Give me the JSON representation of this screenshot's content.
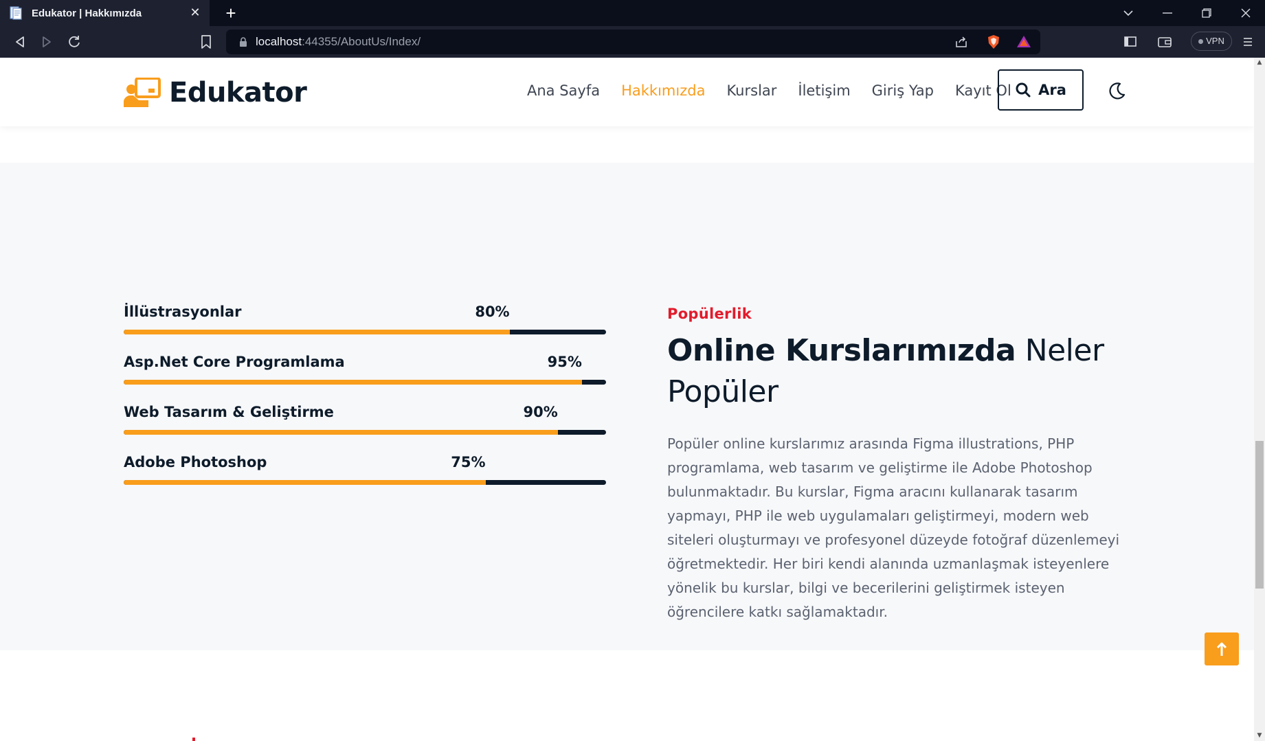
{
  "browser": {
    "tab_title": "Edukator | Hakkımızda",
    "url_host": "localhost",
    "url_rest": ":44355/AboutUs/Index/",
    "vpn_label": "VPN"
  },
  "header": {
    "logo_text": "Edukator",
    "menu": [
      {
        "label": "Ana Sayfa",
        "active": false
      },
      {
        "label": "Hakkımızda",
        "active": true
      },
      {
        "label": "Kurslar",
        "active": false
      },
      {
        "label": "İletişim",
        "active": false
      },
      {
        "label": "Giriş Yap",
        "active": false
      },
      {
        "label": "Kayıt Ol",
        "active": false
      }
    ],
    "search_label": "Ara"
  },
  "skills": [
    {
      "name": "İllüstrasyonlar",
      "percent_label": "80%",
      "percent": 80
    },
    {
      "name": "Asp.Net Core Programlama",
      "percent_label": "95%",
      "percent": 95
    },
    {
      "name": "Web Tasarım & Geliştirme",
      "percent_label": "90%",
      "percent": 90
    },
    {
      "name": "Adobe Photoshop",
      "percent_label": "75%",
      "percent": 75
    }
  ],
  "content": {
    "eyebrow": "Popülerlik",
    "headline_bold": "Online Kurslarımızda",
    "headline_rest": " Neler Popüler",
    "body": "Popüler online kurslarımız arasında Figma illustrations, PHP programlama, web tasarım ve geliştirme ile Adobe Photoshop bulunmaktadır. Bu kurslar, Figma aracını kullanarak tasarım yapmayı, PHP ile web uygulamaları geliştirmeyi, modern web siteleri oluşturmayı ve profesyonel düzeyde fotoğraf düzenlemeyi öğretmektedir. Her biri kendi alanında uzmanlaşmak isteyenlere yönelik bu kurslar, bilgi ve becerilerini geliştirmek isteyen öğrencilere katkı sağlamaktadır."
  },
  "colors": {
    "accent": "#f99d1c",
    "dark": "#0d1b2a",
    "eyebrow_red": "#e21b2b",
    "section_bg": "#f7f8fa"
  },
  "icons": {
    "scroll_top": "arrow-up-icon"
  }
}
